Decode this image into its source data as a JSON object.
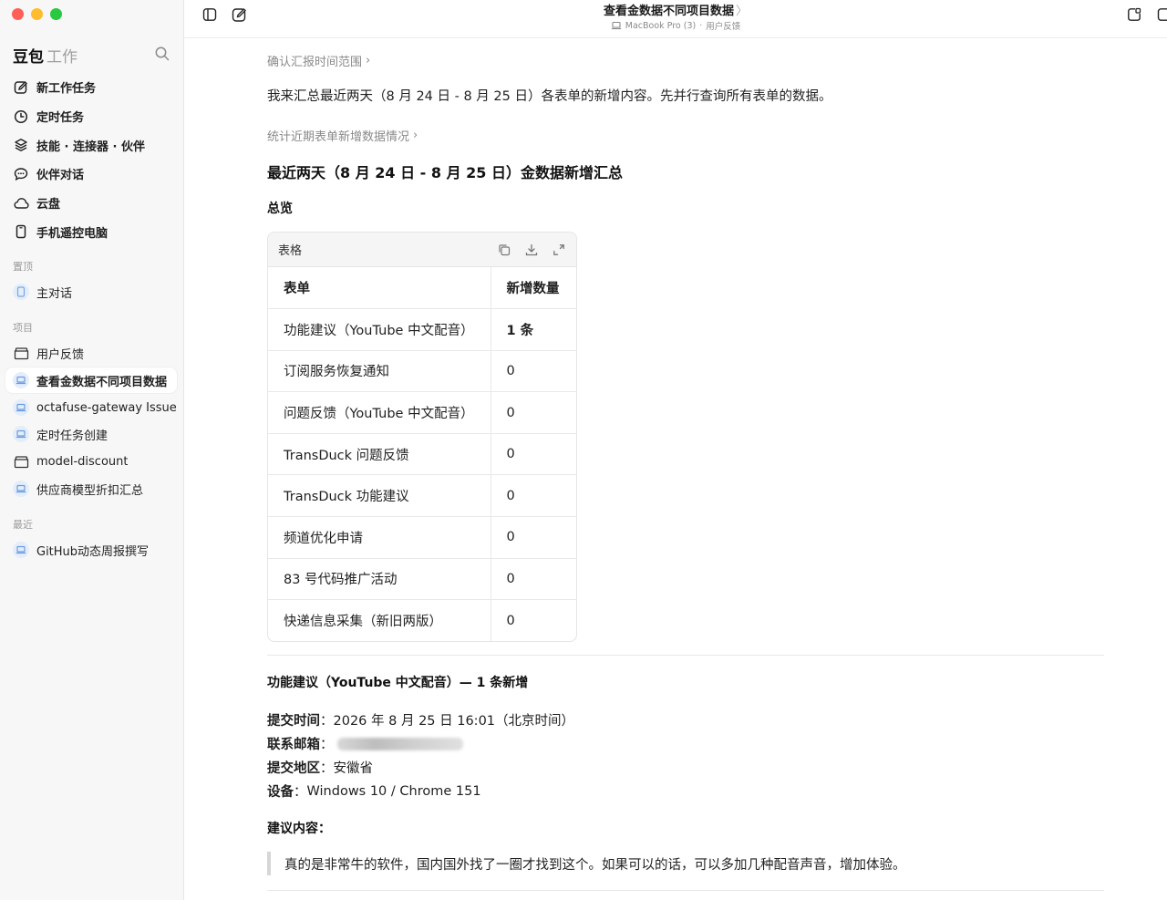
{
  "sidebar": {
    "brand_main": "豆包",
    "brand_sub": "工作",
    "nav": [
      {
        "label": "新工作任务",
        "icon": "edit-icon"
      },
      {
        "label": "定时任务",
        "icon": "clock-icon"
      },
      {
        "label": "技能 · 连接器 · 伙伴",
        "icon": "layers-icon"
      },
      {
        "label": "伙伴对话",
        "icon": "chat-icon"
      },
      {
        "label": "云盘",
        "icon": "cloud-icon"
      },
      {
        "label": "手机遥控电脑",
        "icon": "phone-icon"
      }
    ],
    "pinned_label": "置顶",
    "pinned": [
      {
        "label": "主对话"
      }
    ],
    "projects_label": "项目",
    "projects": [
      {
        "label": "用户反馈",
        "icon": "folder-icon"
      },
      {
        "label": "查看金数据不同项目数据",
        "icon": "laptop-icon",
        "active": true
      },
      {
        "label": "octafuse-gateway Issue",
        "icon": "laptop-icon"
      },
      {
        "label": "定时任务创建",
        "icon": "laptop-icon"
      },
      {
        "label": "model-discount",
        "icon": "folder-icon"
      },
      {
        "label": "供应商模型折扣汇总",
        "icon": "laptop-icon"
      }
    ],
    "recent_label": "最近",
    "recent": [
      {
        "label": "GitHub动态周报撰写"
      }
    ]
  },
  "topbar": {
    "title": "查看金数据不同项目数据",
    "device": "MacBook Pro (3)",
    "separator": "·",
    "project": "用户反馈"
  },
  "content": {
    "step1": "确认汇报时间范围",
    "intro": "我来汇总最近两天（8 月 24 日 - 8 月 25 日）各表单的新增内容。先并行查询所有表单的数据。",
    "step2": "统计近期表单新增数据情况",
    "heading": "最近两天（8 月 24 日 - 8 月 25 日）金数据新增汇总",
    "overview": "总览",
    "table_title": "表格",
    "table": {
      "headers": [
        "表单",
        "新增数量"
      ],
      "rows": [
        [
          "功能建议（YouTube 中文配音）",
          "1 条"
        ],
        [
          "订阅服务恢复通知",
          "0"
        ],
        [
          "问题反馈（YouTube 中文配音）",
          "0"
        ],
        [
          "TransDuck 问题反馈",
          "0"
        ],
        [
          "TransDuck 功能建议",
          "0"
        ],
        [
          "频道优化申请",
          "0"
        ],
        [
          "83 号代码推广活动",
          "0"
        ],
        [
          "快递信息采集（新旧两版）",
          "0"
        ]
      ]
    },
    "detail_heading": "功能建议（YouTube 中文配音）— 1 条新增",
    "fields": {
      "submit_time_label": "提交时间",
      "submit_time": "2026 年 8 月 25 日 16:01（北京时间）",
      "email_label": "联系邮箱",
      "region_label": "提交地区",
      "region": "安徽省",
      "device_label": "设备",
      "device": "Windows 10 / Chrome 151"
    },
    "suggestion_label": "建议内容：",
    "suggestion": "真的是非常牛的软件，国内国外找了一圈才找到这个。如果可以的话，可以多加几种配音声音，增加体验。"
  }
}
